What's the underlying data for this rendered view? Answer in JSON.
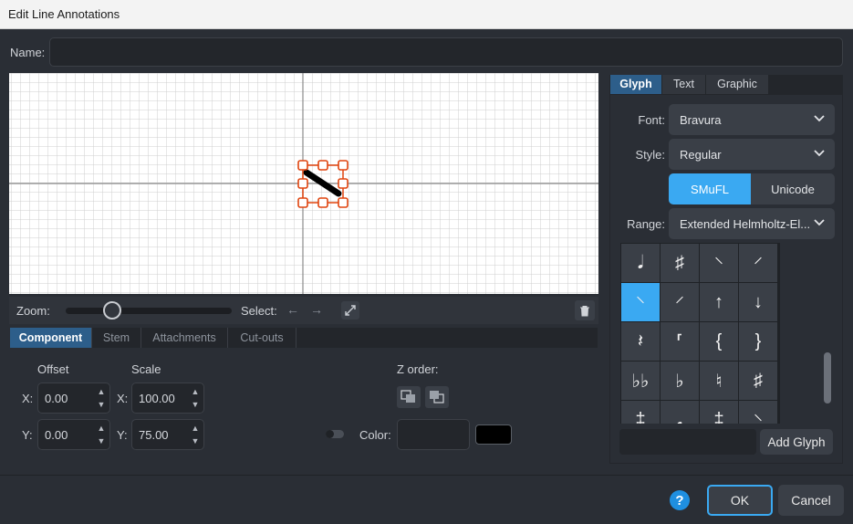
{
  "window": {
    "title": "Edit Line Annotations"
  },
  "name_field": {
    "label": "Name:",
    "value": ""
  },
  "zoom_bar": {
    "zoom_label": "Zoom:",
    "zoom_level": 0.25,
    "select_label": "Select:",
    "prev_glyph": "←",
    "next_glyph": "→"
  },
  "bottom_tabs": [
    {
      "label": "Component",
      "active": true
    },
    {
      "label": "Stem",
      "active": false
    },
    {
      "label": "Attachments",
      "active": false
    },
    {
      "label": "Cut-outs",
      "active": false
    }
  ],
  "component": {
    "offset_label": "Offset",
    "scale_label": "Scale",
    "x_label": "X:",
    "y_label": "Y:",
    "offset_x": "0.00",
    "offset_y": "0.00",
    "scale_x": "100.00",
    "scale_y": "75.00",
    "z_order_label": "Z order:",
    "color_label": "Color:",
    "color_value": "#000000"
  },
  "right_tabs": [
    {
      "label": "Glyph",
      "active": true
    },
    {
      "label": "Text",
      "active": false
    },
    {
      "label": "Graphic",
      "active": false
    }
  ],
  "glyph": {
    "font_label": "Font:",
    "font_value": "Bravura",
    "style_label": "Style:",
    "style_value": "Regular",
    "smufl_label": "SMuFL",
    "unicode_label": "Unicode",
    "range_label": "Range:",
    "range_value": "Extended Helmholtz-El...",
    "grid": [
      [
        "𝅘𝅥",
        "♯",
        "⸌",
        "⸍"
      ],
      [
        "⸌",
        "⸍",
        "↑",
        "↓"
      ],
      [
        "𝄽",
        "⸢",
        "{",
        "}"
      ],
      [
        "♭♭",
        "♭",
        "♮",
        "♯"
      ],
      [
        "‡",
        "𝅘",
        "‡",
        "⸌"
      ]
    ],
    "add_glyph_label": "Add Glyph"
  },
  "footer": {
    "help_label": "?",
    "ok_label": "OK",
    "cancel_label": "Cancel"
  },
  "colors": {
    "accent": "#3aa9f2",
    "selection": "#e0440e",
    "tab_active": "#2d5e8a"
  }
}
